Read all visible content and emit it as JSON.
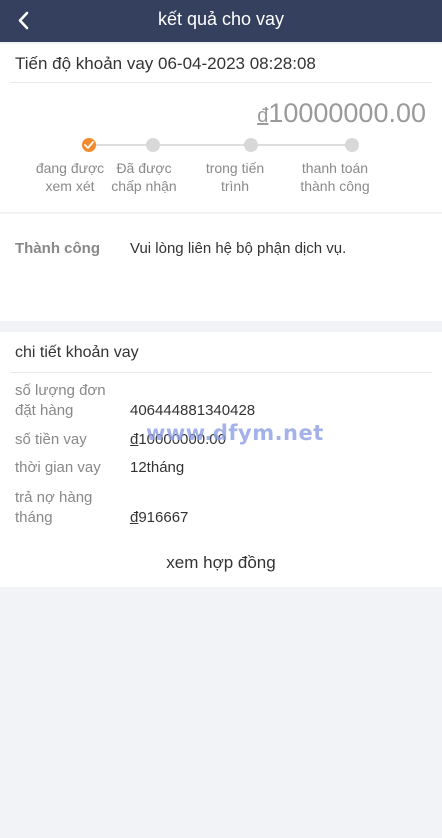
{
  "header": {
    "title": "kết quả cho vay",
    "back_icon": "chevron-left-icon"
  },
  "progress": {
    "title": "Tiến độ khoản vay 06-04-2023 08:28:08",
    "currency": "đ",
    "amount": "10000000.00",
    "accent_color": "#f38a2b",
    "steps": [
      {
        "label": "đang được xem xét",
        "state": "done"
      },
      {
        "label": "Đã được chấp nhận",
        "state": "pending"
      },
      {
        "label": "trong tiến trình",
        "state": "pending"
      },
      {
        "label": "thanh toán thành công",
        "state": "pending"
      }
    ]
  },
  "status": {
    "key": "Thành công",
    "message": "Vui lòng liên hệ bộ phận dịch vụ."
  },
  "details": {
    "title": "chi tiết khoản vay",
    "rows": [
      {
        "key": "số lượng đơn đặt hàng",
        "value": "406444881340428"
      },
      {
        "key": "số tiền vay",
        "currency": "đ",
        "value": "10000000.00"
      },
      {
        "key": "thời gian vay",
        "value": "12tháng"
      },
      {
        "key": "trả nợ hàng tháng",
        "currency": "đ",
        "value": "916667"
      }
    ],
    "contract_link": "xem hợp đồng"
  },
  "watermark": "www.dfym.net"
}
